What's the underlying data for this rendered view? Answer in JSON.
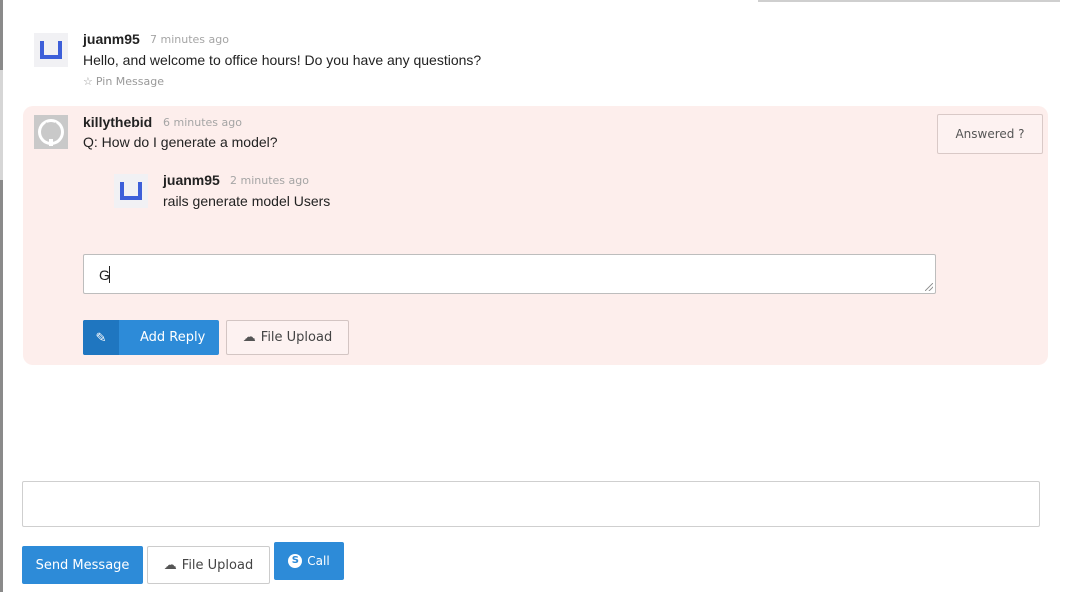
{
  "messages": [
    {
      "username": "juanm95",
      "time": "7 minutes ago",
      "text": "Hello, and welcome to office hours! Do you have any questions?",
      "pin_label": "Pin Message",
      "avatar_icon": "u-logo-icon"
    }
  ],
  "question": {
    "username": "killythebid",
    "time": "6 minutes ago",
    "text": "Q: How do I generate a model?",
    "avatar_icon": "github-icon",
    "answered_label": "Answered ?",
    "reply": {
      "username": "juanm95",
      "time": "2 minutes ago",
      "text": "rails generate model Users",
      "avatar_icon": "u-logo-icon"
    },
    "reply_input_value": "G",
    "add_reply_label": "Add Reply",
    "file_upload_label": "File Upload"
  },
  "composer": {
    "input_value": "",
    "send_label": "Send Message",
    "file_upload_label": "File Upload",
    "call_label": "Call"
  },
  "colors": {
    "accent": "#2d8bd8",
    "question_bg": "#fdeeec",
    "avatar_u": "#3d5fd9"
  }
}
